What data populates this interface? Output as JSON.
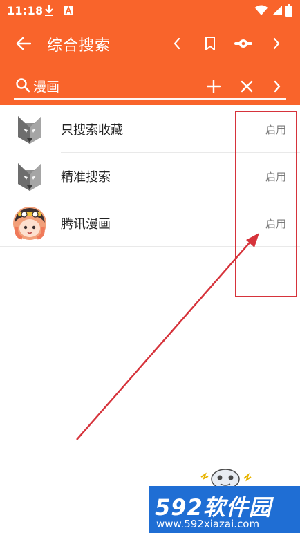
{
  "status_bar": {
    "time": "11:18",
    "icons": [
      "download-icon",
      "font-a-icon",
      "wifi-icon",
      "signal-icon",
      "battery-icon"
    ]
  },
  "toolbar": {
    "title": "综合搜索",
    "icons": [
      "back-arrow-icon",
      "chevron-left-icon",
      "bookmark-icon",
      "slider-toggle-icon",
      "chevron-right-icon"
    ]
  },
  "search": {
    "value": "漫画",
    "icons": [
      "search-icon",
      "plus-icon",
      "close-icon",
      "chevron-right-icon"
    ]
  },
  "sources": [
    {
      "name": "只搜索收藏",
      "status": "启用",
      "avatar": "wolf-logo-icon"
    },
    {
      "name": "精准搜索",
      "status": "启用",
      "avatar": "wolf-logo-icon"
    },
    {
      "name": "腾讯漫画",
      "status": "启用",
      "avatar": "anime-girl-avatar"
    }
  ],
  "watermark": {
    "brand": "592软件园",
    "url": "www.592xiazai.com"
  },
  "colors": {
    "accent": "#f9642b",
    "annotation": "#d6333b",
    "watermark_bg": "#1f6ed4"
  }
}
